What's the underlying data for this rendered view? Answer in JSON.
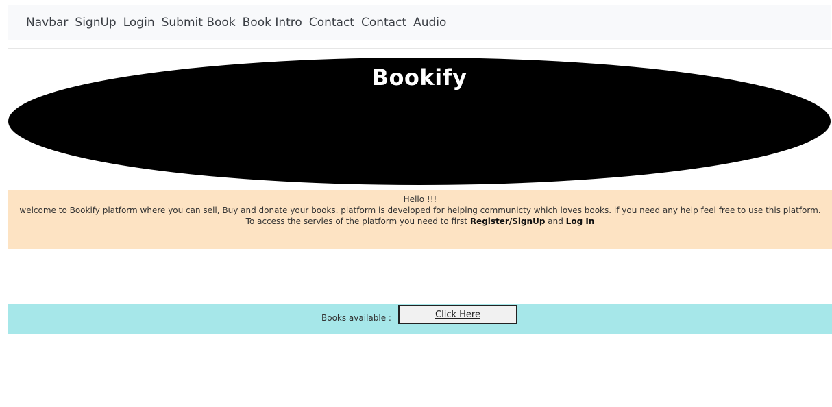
{
  "navbar": {
    "brand": "Navbar",
    "links": [
      "SignUp",
      "Login",
      "Submit Book",
      "Book Intro",
      "Contact",
      "Contact",
      "Audio"
    ]
  },
  "hero": {
    "title": "Bookify"
  },
  "welcome": {
    "greeting": "Hello !!!",
    "message": "welcome to Bookify platform where you can sell, Buy and donate your books. platform is developed for helping communicty which loves books. if you need any help feel free to use this platform.",
    "access_prefix": "To access the servies of the platform you need to first",
    "register_label": "Register/SignUp",
    "and_label": "and",
    "login_label": "Log In"
  },
  "books": {
    "label": "Books available :",
    "button_label": "Click Here"
  }
}
